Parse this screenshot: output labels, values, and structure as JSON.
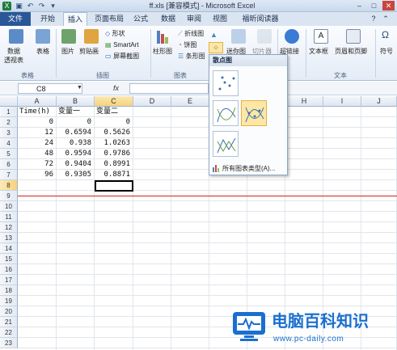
{
  "titlebar": {
    "title": "ff.xls  [兼容模式]  -  Microsoft Excel"
  },
  "tabs": [
    {
      "label": "文件"
    },
    {
      "label": "开始"
    },
    {
      "label": "插入"
    },
    {
      "label": "页面布局"
    },
    {
      "label": "公式"
    },
    {
      "label": "数据"
    },
    {
      "label": "审阅"
    },
    {
      "label": "视图"
    },
    {
      "label": "福昕阅读器"
    }
  ],
  "ribbon": {
    "pivot": {
      "line1": "数据",
      "line2": "透视表"
    },
    "table": "表格",
    "picture": "图片",
    "clipart": "剪贴画",
    "shapes": "形状",
    "smartart": "SmartArt",
    "screenshot": "屏幕截图",
    "column": "柱形图",
    "line": "折线图",
    "pie": "饼图",
    "bar": "条形图",
    "sparkline": "迷你图",
    "slicer": "切片器",
    "hyperlink": "超链接",
    "textbox": "文本框",
    "header": "页眉和页脚",
    "symbol": "符号",
    "groups": {
      "tables": "表格",
      "illustrations": "插图",
      "charts": "图表",
      "text": "文本"
    }
  },
  "formula_bar": {
    "namebox": "C8",
    "fx": "fx",
    "value": ""
  },
  "grid": {
    "columns": [
      "A",
      "B",
      "C",
      "D",
      "E",
      "F",
      "G",
      "H",
      "I",
      "J"
    ],
    "rows": [
      "1",
      "2",
      "3",
      "4",
      "5",
      "6",
      "7",
      "8",
      "9",
      "10",
      "11",
      "12",
      "13",
      "14",
      "15",
      "16",
      "17",
      "18",
      "19",
      "20",
      "21",
      "22",
      "23"
    ],
    "headers": [
      "Time(h)",
      "变量一",
      "变量二"
    ],
    "data": [
      [
        "0",
        "0",
        "0"
      ],
      [
        "12",
        "0.6594",
        "0.5626"
      ],
      [
        "24",
        "0.938",
        "1.0263"
      ],
      [
        "48",
        "0.9594",
        "0.9786"
      ],
      [
        "72",
        "0.9404",
        "0.8991"
      ],
      [
        "96",
        "0.9305",
        "0.8871"
      ]
    ]
  },
  "dropdown": {
    "title": "散点图",
    "all_types": "所有图表类型(A)..."
  },
  "watermark": {
    "text": "电脑百科知识",
    "url": "www.pc-daily.com",
    "accent": "#1a6fd0"
  },
  "colors": {
    "file_tab": "#2b5797",
    "selection": "#000000",
    "red_line": "#d42020"
  }
}
